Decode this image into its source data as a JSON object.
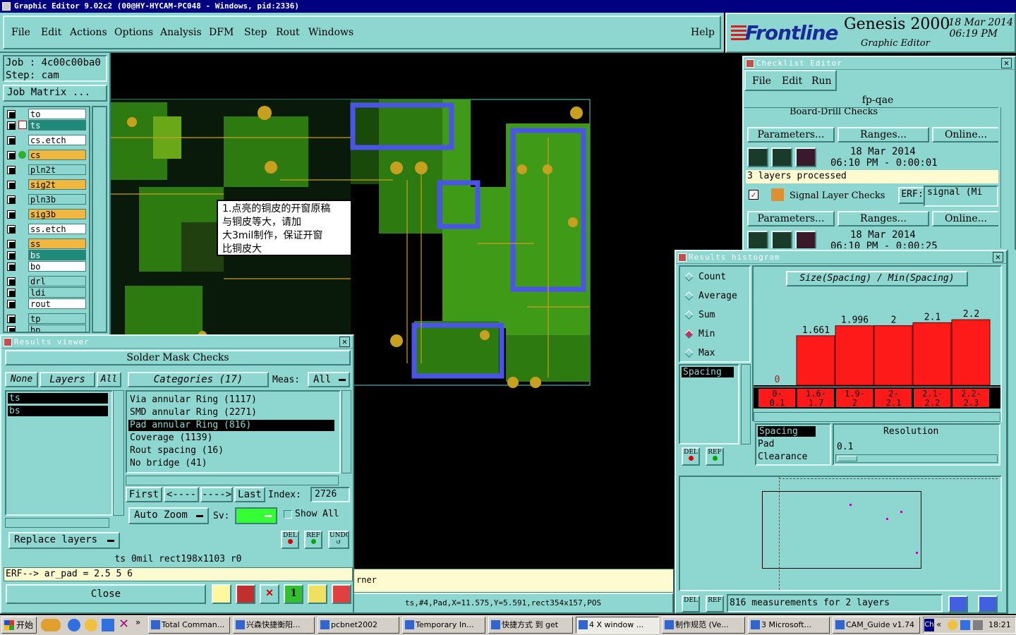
{
  "window_title": "Graphic Editor 9.02c2 (00@HY-HYCAM-PC048 - Windows, pid:2336)",
  "menu": [
    "File",
    "Edit",
    "Actions",
    "Options",
    "Analysis",
    "DFM",
    "Step",
    "Rout",
    "Windows"
  ],
  "help": "Help",
  "brand": {
    "logo": "Frontline",
    "product": "Genesis 2000",
    "subtitle": "Graphic Editor",
    "date": "18 Mar 2014",
    "time": "06:19 PM"
  },
  "job": {
    "job": "Job : 4c00c00ba0",
    "step": "Step: cam",
    "matrix": "Job Matrix ..."
  },
  "layers": [
    {
      "name": "to",
      "color": "#ffffff"
    },
    {
      "name": "ts",
      "color": "#1e8a7a"
    },
    {
      "name": "cs.etch",
      "color": "#ffffff"
    },
    {
      "name": "cs",
      "color": "#f0b840"
    },
    {
      "name": "pln2t",
      "color": "#8ed6d0"
    },
    {
      "name": "sig2t",
      "color": "#f0b840"
    },
    {
      "name": "pln3b",
      "color": "#8ed6d0"
    },
    {
      "name": "sig3b",
      "color": "#f0b840"
    },
    {
      "name": "ss.etch",
      "color": "#ffffff"
    },
    {
      "name": "ss",
      "color": "#f0b840"
    },
    {
      "name": "bs",
      "color": "#1e8a7a"
    },
    {
      "name": "bo",
      "color": "#ffffff"
    },
    {
      "name": "drl",
      "color": "#8ed6d0"
    },
    {
      "name": "ldi",
      "color": "#8ed6d0"
    },
    {
      "name": "rout",
      "color": "#ffffff"
    },
    {
      "name": "tp",
      "color": "#8ed6d0"
    },
    {
      "name": "bp",
      "color": "#8ed6d0"
    }
  ],
  "annotation": [
    "1.点亮的铜皮的开窗原稿",
    "与铜皮等大，请加",
    "大3mil制作，保证开窗",
    "比铜皮大"
  ],
  "results_viewer": {
    "title": "Results viewer",
    "header": "Solder Mask Checks",
    "none": "None",
    "layers": "Layers",
    "all": "All",
    "categories": "Categories (17)",
    "meas_label": "Meas:",
    "meas_value": "All",
    "layer_items": [
      "ts",
      "bs"
    ],
    "category_items": [
      "Via annular Ring (1117)",
      "SMD annular Ring (2271)",
      "Pad annular Ring (816)",
      "Coverage (1139)",
      "Rout spacing (16)",
      "No bridge (41)"
    ],
    "selected_category": "Pad annular Ring (816)",
    "first": "First",
    "prev": "<----",
    "next": "---->",
    "last": "Last",
    "index_label": "Index:",
    "index_value": "2726",
    "auto_zoom": "Auto Zoom",
    "sv": "Sv:",
    "show_all": "Show All",
    "del": "DEL",
    "ref": "REF",
    "undo": "UNDO",
    "replace_layers": "Replace layers",
    "status1": "ts 0mil rect198x1103 r0",
    "status2": "ERF--> ar_pad = 2.5 5 6",
    "close": "Close"
  },
  "status_bar": {
    "left": "rner",
    "coords": "ts,#4,Pad,X=11.575,Y=5.591,rect354x157,POS"
  },
  "checklist": {
    "title": "Checklist Editor",
    "menu": [
      "File",
      "Edit",
      "Run"
    ],
    "name": "fp-qae",
    "row0": "Board-Drill Checks",
    "params": "Parameters...",
    "ranges": "Ranges...",
    "online": "Online...",
    "date1": "18 Mar 2014",
    "time1": "06:10 PM - 0:00:01",
    "processed": "3 layers processed",
    "row2": "Signal Layer Checks",
    "erf": "ERF:",
    "erf_val": "signal (Mi",
    "date2": "18 Mar 2014",
    "time2": "06:10 PM - 0:00:25"
  },
  "histogram": {
    "title": "Results histogram",
    "options": [
      "Count",
      "Average",
      "Sum",
      "Min",
      "Max"
    ],
    "selected": "Min",
    "list": [
      "Spacing"
    ],
    "chart_title": "Size(Spacing) / Min(Spacing)",
    "resolution_label": "Resolution",
    "resolution": "0.1",
    "list2": [
      "Spacing",
      "Pad",
      "Clearance"
    ],
    "del": "DEL",
    "ref": "REF",
    "summary": "816 measurements for 2 layers"
  },
  "chart_data": {
    "type": "bar",
    "categories": [
      "0-0.1",
      "1.6-1.7",
      "1.9-2",
      "2-2.1",
      "2.1-2.2",
      "2.2-2.3"
    ],
    "category_labels": [
      [
        "0-",
        "0.1"
      ],
      [
        "1.6-",
        "1.7"
      ],
      [
        "1.9-",
        "2"
      ],
      [
        "2-",
        "2.1"
      ],
      [
        "2.1-",
        "2.2"
      ],
      [
        "2.2-",
        "2.3"
      ]
    ],
    "values": [
      0,
      1.661,
      1.996,
      2,
      2.1,
      2.2
    ],
    "value_labels": [
      "0",
      "1.661",
      "1.996",
      "2",
      "2.1",
      "2.2"
    ],
    "title": "Size(Spacing) / Min(Spacing)",
    "ylim": [
      0,
      2.7
    ],
    "bar_color": "#ff1a1a"
  },
  "taskbar": {
    "start": "开始",
    "items": [
      "Total Comman...",
      "兴森快捷衡阳...",
      "pcbnet2002",
      "Temporary In...",
      "快捷方式 到 get",
      "4 X window ...",
      "制作规范 (Ve...",
      "3 Microsoft...",
      "CAM_Guide v1.74"
    ],
    "clock": "18:21"
  }
}
